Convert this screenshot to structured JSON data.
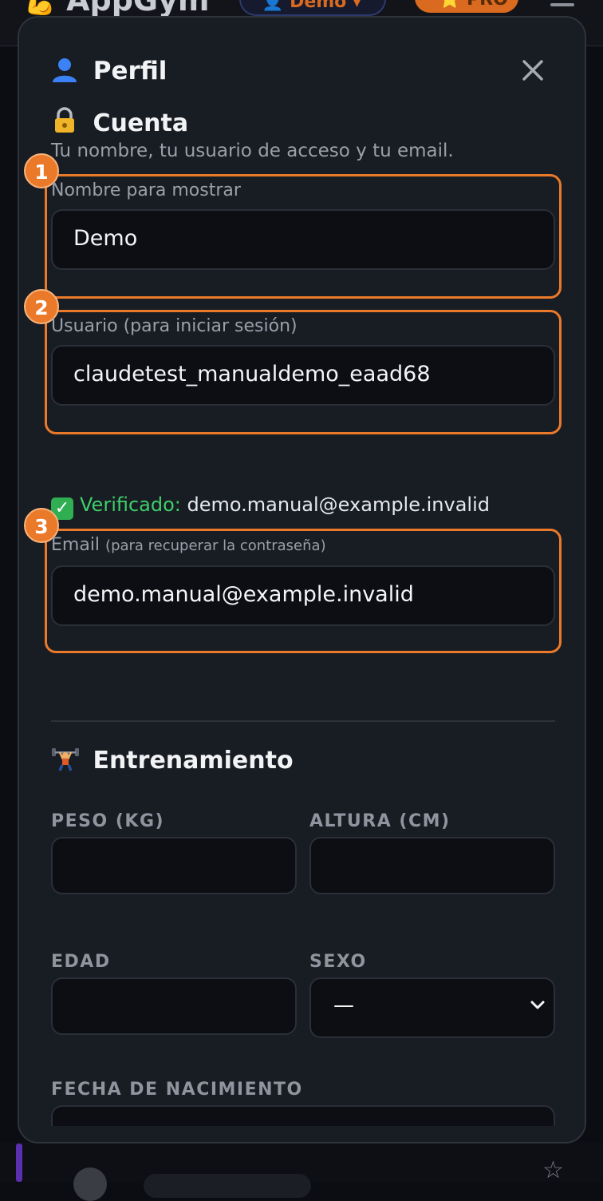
{
  "app": {
    "logo_text": "AppGym",
    "user_label": "Demo",
    "pro_label": "PRO"
  },
  "modal": {
    "title": "Perfil",
    "close_glyph": "✕"
  },
  "account": {
    "title": "Cuenta",
    "subtitle": "Tu nombre, tu usuario de acceso y tu email.",
    "display_name": {
      "badge": "1",
      "label": "Nombre para mostrar",
      "value": "Demo"
    },
    "username": {
      "badge": "2",
      "label": "Usuario (para iniciar sesión)",
      "value": "claudetest_manualdemo_eaad68"
    },
    "verified": {
      "status": "Verificado:",
      "email": "demo.manual@example.invalid"
    },
    "email": {
      "badge": "3",
      "label": "Email",
      "label_hint": "(para recuperar la contraseña)",
      "value": "demo.manual@example.invalid"
    }
  },
  "training": {
    "title": "Entrenamiento",
    "weight": {
      "label": "PESO (KG)",
      "value": ""
    },
    "height": {
      "label": "ALTURA (CM)",
      "value": ""
    },
    "age": {
      "label": "EDAD",
      "value": ""
    },
    "sex": {
      "label": "SEXO",
      "value": "—"
    },
    "birthdate": {
      "label": "FECHA DE NACIMIENTO",
      "value": ""
    }
  },
  "icons": {
    "title_icon": "user-icon",
    "account_icon": "lock-key-icon",
    "training_icon": "weightlifter-icon",
    "verified_icon": "check-box-icon"
  },
  "colors": {
    "accent": "#ea7a2a",
    "verified": "#3ecf6a",
    "modal_bg": "#181c23",
    "input_bg": "#0c0e13"
  }
}
